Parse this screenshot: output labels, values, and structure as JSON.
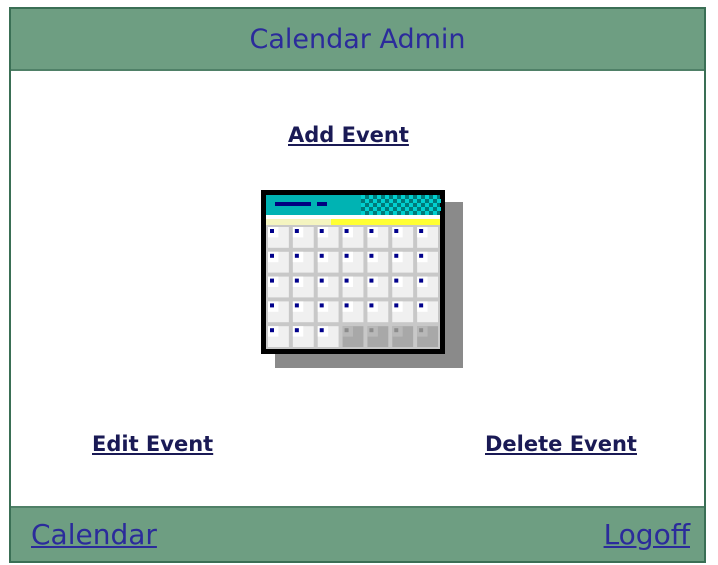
{
  "header": {
    "title": "Calendar Admin"
  },
  "actions": {
    "add_event": "Add Event",
    "edit_event": "Edit Event",
    "delete_event": "Delete Event"
  },
  "footer": {
    "calendar_link": "Calendar",
    "logoff_link": "Logoff"
  },
  "colors": {
    "header_bg": "#6e9e82",
    "link_dark": "#1a1a55",
    "link_blue": "#2b2b9b",
    "icon_titlebar": "#00b3b3",
    "icon_dots": "#00008b",
    "icon_stripe": "#ffff33"
  },
  "icons": {
    "calendar": "calendar-icon"
  }
}
